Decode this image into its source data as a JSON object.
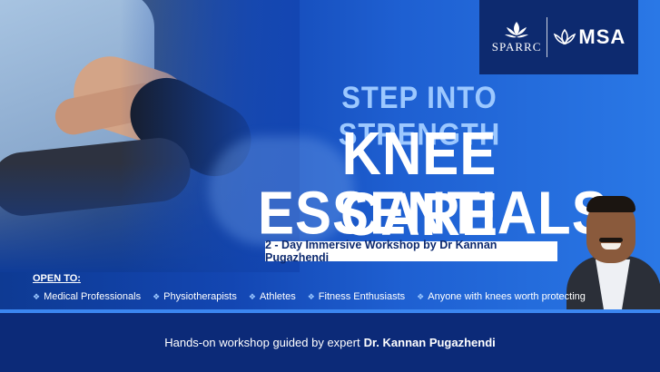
{
  "logos": {
    "sparrc": "SPARRC",
    "msa": "MSA"
  },
  "headline": {
    "kicker": "STEP INTO STRENGTH",
    "title_line1": "KNEE CARE",
    "title_line2": "ESSENTIALS",
    "subtitle": "2 - Day Immersive Workshop by Dr Kannan Pugazhendi"
  },
  "audience": {
    "label": "OPEN TO:",
    "items": [
      "Medical Professionals",
      "Physiotherapists",
      "Athletes",
      "Fitness Enthusiasts",
      "Anyone with knees worth protecting"
    ]
  },
  "footer": {
    "text": "Hands-on workshop guided by expert",
    "name": "Dr. Kannan Pugazhendi"
  },
  "colors": {
    "background": "#1346b2",
    "kicker": "#9cc8ff",
    "logo_box": "#0d2a6f",
    "footer": "#0c2a78"
  }
}
